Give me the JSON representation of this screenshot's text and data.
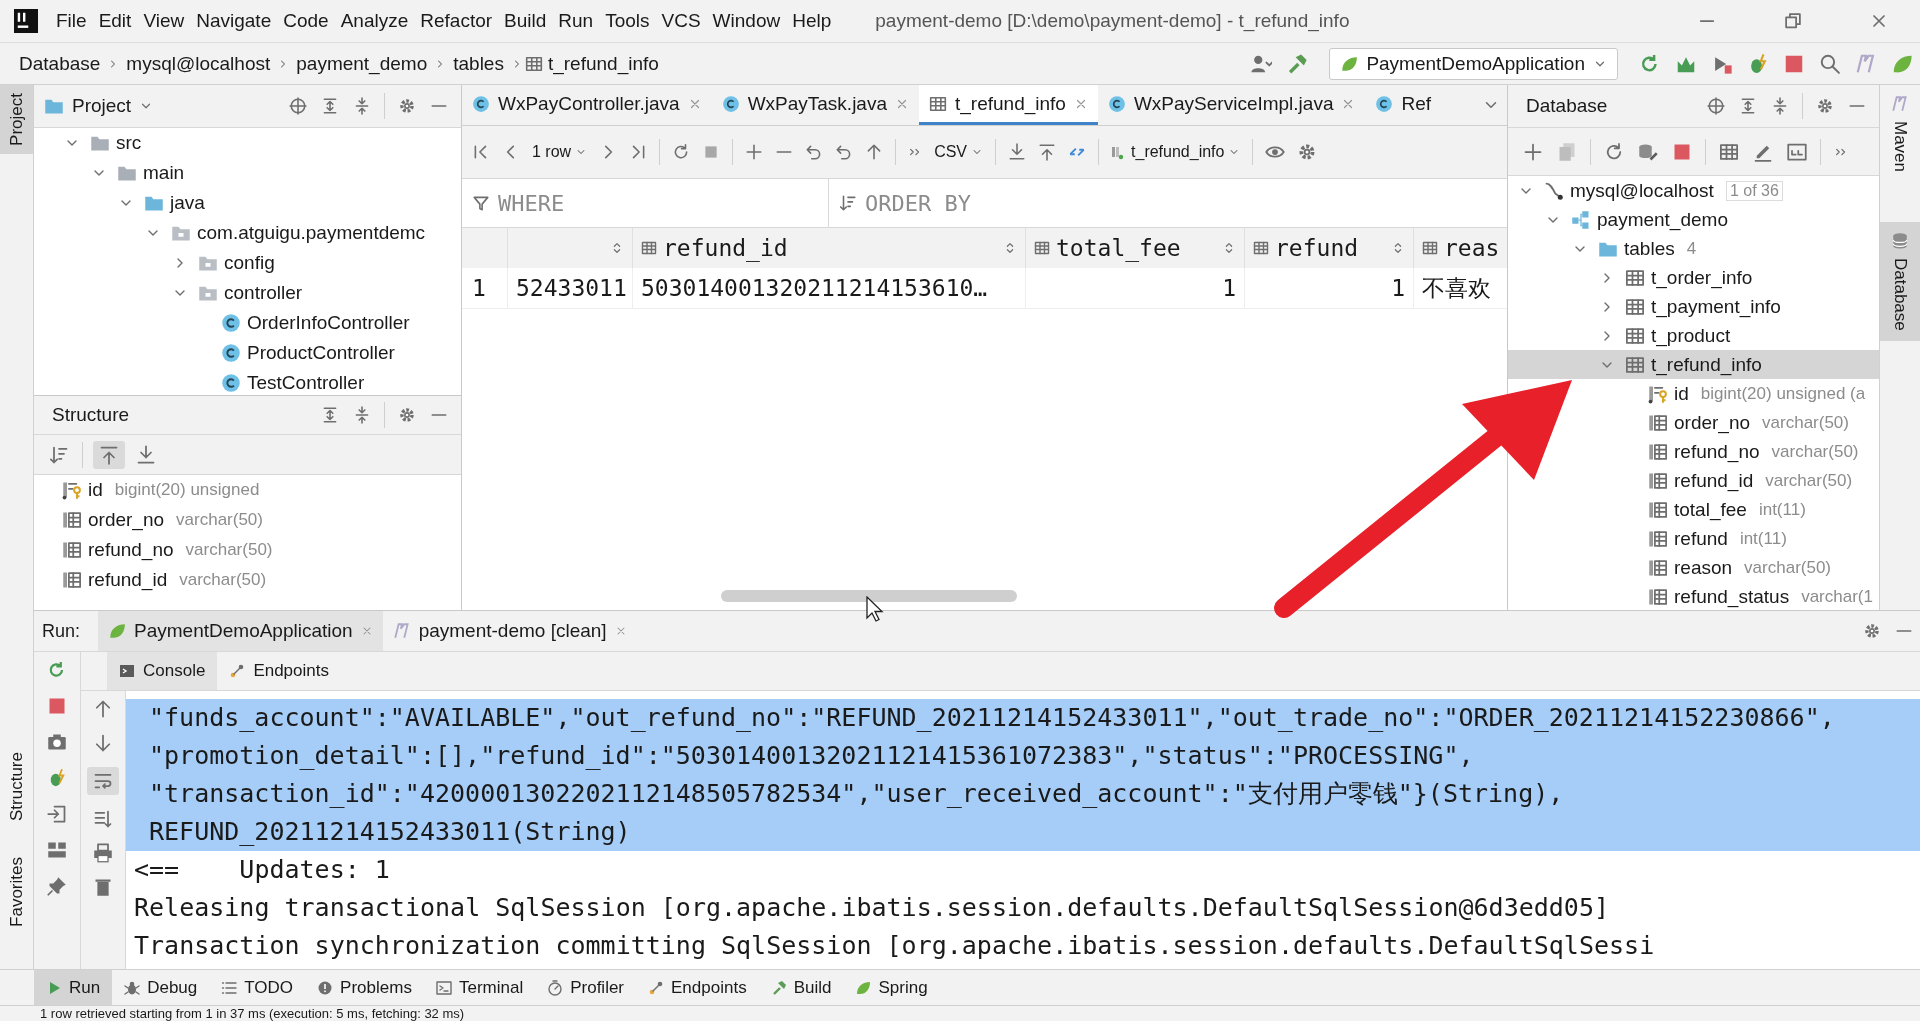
{
  "window": {
    "title": "payment-demo [D:\\demo\\payment-demo] - t_refund_info"
  },
  "menu": [
    "File",
    "Edit",
    "View",
    "Navigate",
    "Code",
    "Analyze",
    "Refactor",
    "Build",
    "Run",
    "Tools",
    "VCS",
    "Window",
    "Help"
  ],
  "breadcrumbs": [
    {
      "label": "Database",
      "kind": "plain"
    },
    {
      "label": "mysql@localhost",
      "kind": "plain"
    },
    {
      "label": "payment_demo",
      "kind": "plain"
    },
    {
      "label": "tables",
      "kind": "plain"
    },
    {
      "label": "t_refund_info",
      "kind": "table"
    }
  ],
  "run_config": {
    "label": "PaymentDemoApplication"
  },
  "left_stripe": [
    {
      "label": "Project",
      "selected": true
    },
    {
      "label": "Structure",
      "selected": false
    },
    {
      "label": "Favorites",
      "selected": false
    }
  ],
  "project": {
    "title": "Project",
    "tree": [
      {
        "label": "src",
        "kind": "folder",
        "expanded": true,
        "children": [
          {
            "label": "main",
            "kind": "folder",
            "expanded": true,
            "children": [
              {
                "label": "java",
                "kind": "source-folder",
                "expanded": true,
                "children": [
                  {
                    "label": "com.atguigu.paymentdemc",
                    "kind": "package",
                    "expanded": true,
                    "children": [
                      {
                        "label": "config",
                        "kind": "package",
                        "expanded": false
                      },
                      {
                        "label": "controller",
                        "kind": "package",
                        "expanded": true,
                        "children": [
                          {
                            "label": "OrderInfoController",
                            "kind": "class"
                          },
                          {
                            "label": "ProductController",
                            "kind": "class"
                          },
                          {
                            "label": "TestController",
                            "kind": "class"
                          }
                        ]
                      }
                    ]
                  }
                ]
              }
            ]
          }
        ]
      }
    ]
  },
  "structure": {
    "title": "Structure",
    "items": [
      {
        "name": "id",
        "type": "bigint(20) unsigned",
        "kind": "key-column"
      },
      {
        "name": "order_no",
        "type": "varchar(50)",
        "kind": "column"
      },
      {
        "name": "refund_no",
        "type": "varchar(50)",
        "kind": "column"
      },
      {
        "name": "refund_id",
        "type": "varchar(50)",
        "kind": "column"
      }
    ]
  },
  "editor_tabs": [
    {
      "label": "WxPayController.java",
      "kind": "class",
      "selected": false,
      "closable": true
    },
    {
      "label": "WxPayTask.java",
      "kind": "class",
      "selected": false,
      "closable": true
    },
    {
      "label": "t_refund_info",
      "kind": "table",
      "selected": true,
      "closable": true
    },
    {
      "label": "WxPayServiceImpl.java",
      "kind": "class",
      "selected": false,
      "closable": true
    },
    {
      "label": "Ref",
      "kind": "class",
      "selected": false,
      "closable": false
    }
  ],
  "grid_toolbar": {
    "page_size": "1 row",
    "export_format": "CSV",
    "table": "t_refund_info"
  },
  "filter": {
    "where": {
      "placeholder": "WHERE"
    },
    "order_by": {
      "placeholder": "ORDER BY"
    }
  },
  "table": {
    "columns": [
      {
        "kind": "text"
      },
      {
        "label": "refund_id",
        "kind": "text"
      },
      {
        "label": "total_fee",
        "kind": "number"
      },
      {
        "label": "refund",
        "kind": "number"
      },
      {
        "label": "reas",
        "kind": "text"
      }
    ],
    "rows": [
      {
        "number": "1",
        "cells": [
          "52433011",
          "503014001320211214153610…",
          "1",
          "1",
          "不喜欢"
        ]
      }
    ]
  },
  "database": {
    "title": "Database",
    "tree": [
      {
        "label": "mysql@localhost",
        "kind": "connection",
        "badge": "1 of 36",
        "expanded": true,
        "selected": false,
        "children": [
          {
            "label": "payment_demo",
            "kind": "schema",
            "expanded": true,
            "selected": false,
            "children": [
              {
                "label": "tables",
                "kind": "folder",
                "count": "4",
                "expanded": true,
                "selected": false,
                "children": [
                  {
                    "label": "t_order_info",
                    "kind": "table",
                    "expanded": false,
                    "selected": false
                  },
                  {
                    "label": "t_payment_info",
                    "kind": "table",
                    "expanded": false,
                    "selected": false
                  },
                  {
                    "label": "t_product",
                    "kind": "table",
                    "expanded": false,
                    "selected": false
                  },
                  {
                    "label": "t_refund_info",
                    "kind": "table",
                    "expanded": true,
                    "selected": true,
                    "children": [
                      {
                        "label": "id",
                        "kind": "key-column",
                        "type": "bigint(20) unsigned (a",
                        "selected": false
                      },
                      {
                        "label": "order_no",
                        "kind": "column",
                        "type": "varchar(50)",
                        "selected": false
                      },
                      {
                        "label": "refund_no",
                        "kind": "column",
                        "type": "varchar(50)",
                        "selected": false
                      },
                      {
                        "label": "refund_id",
                        "kind": "column",
                        "type": "varchar(50)",
                        "selected": false
                      },
                      {
                        "label": "total_fee",
                        "kind": "column",
                        "type": "int(11)",
                        "selected": false
                      },
                      {
                        "label": "refund",
                        "kind": "column",
                        "type": "int(11)",
                        "selected": false
                      },
                      {
                        "label": "reason",
                        "kind": "column",
                        "type": "varchar(50)",
                        "selected": false
                      },
                      {
                        "label": "refund_status",
                        "kind": "column",
                        "type": "varchar(1",
                        "selected": false
                      }
                    ]
                  }
                ]
              }
            ]
          }
        ]
      }
    ]
  },
  "right_stripe": [
    {
      "label": "Maven",
      "selected": false
    },
    {
      "label": "Database",
      "selected": true
    }
  ],
  "run": {
    "label": "Run:",
    "tabs": [
      {
        "label": "PaymentDemoApplication",
        "kind": "spring",
        "selected": true,
        "closable": true
      },
      {
        "label": "payment-demo [clean]",
        "kind": "maven",
        "selected": false,
        "closable": true
      }
    ],
    "subtabs": [
      {
        "label": "Console",
        "kind": "console",
        "selected": true
      },
      {
        "label": "Endpoints",
        "kind": "endpoints",
        "selected": false
      }
    ],
    "console": [
      {
        "text": "\"funds_account\":\"AVAILABLE\",\"out_refund_no\":\"REFUND_20211214152433011\",\"out_trade_no\":\"ORDER_20211214152230866\",",
        "kind": "continuation",
        "selected": true
      },
      {
        "text": "\"promotion_detail\":[],\"refund_id\":\"50301400132021121415361072383\",\"status\":\"PROCESSING\",",
        "kind": "continuation",
        "selected": true
      },
      {
        "text": "\"transaction_id\":\"4200001302202112148505782534\",\"user_received_account\":\"支付用户零钱\"}(String),",
        "kind": "continuation",
        "selected": true
      },
      {
        "text": "REFUND_20211214152433011(String)",
        "kind": "continuation",
        "selected": true
      },
      {
        "text": "<==    Updates: 1",
        "kind": "plain",
        "selected": false
      },
      {
        "text": "Releasing transactional SqlSession [org.apache.ibatis.session.defaults.DefaultSqlSession@6d3edd05]",
        "kind": "plain",
        "selected": false
      },
      {
        "text": "Transaction synchronization committing SqlSession [org.apache.ibatis.session.defaults.DefaultSqlSessi",
        "kind": "plain",
        "selected": false
      }
    ]
  },
  "tool_tabs": [
    {
      "label": "Run",
      "kind": "run",
      "selected": true
    },
    {
      "label": "Debug",
      "kind": "bug",
      "selected": false
    },
    {
      "label": "TODO",
      "kind": "list",
      "selected": false
    },
    {
      "label": "Problems",
      "kind": "problems",
      "selected": false
    },
    {
      "label": "Terminal",
      "kind": "terminal",
      "selected": false
    },
    {
      "label": "Profiler",
      "kind": "profiler",
      "selected": false
    },
    {
      "label": "Endpoints",
      "kind": "endpoints",
      "selected": false
    },
    {
      "label": "Build",
      "kind": "hammer",
      "selected": false
    },
    {
      "label": "Spring",
      "kind": "spring",
      "selected": false
    }
  ],
  "status_bar": {
    "message": "1 row retrieved starting from 1 in 37 ms (execution: 5 ms, fetching: 32 ms)"
  }
}
